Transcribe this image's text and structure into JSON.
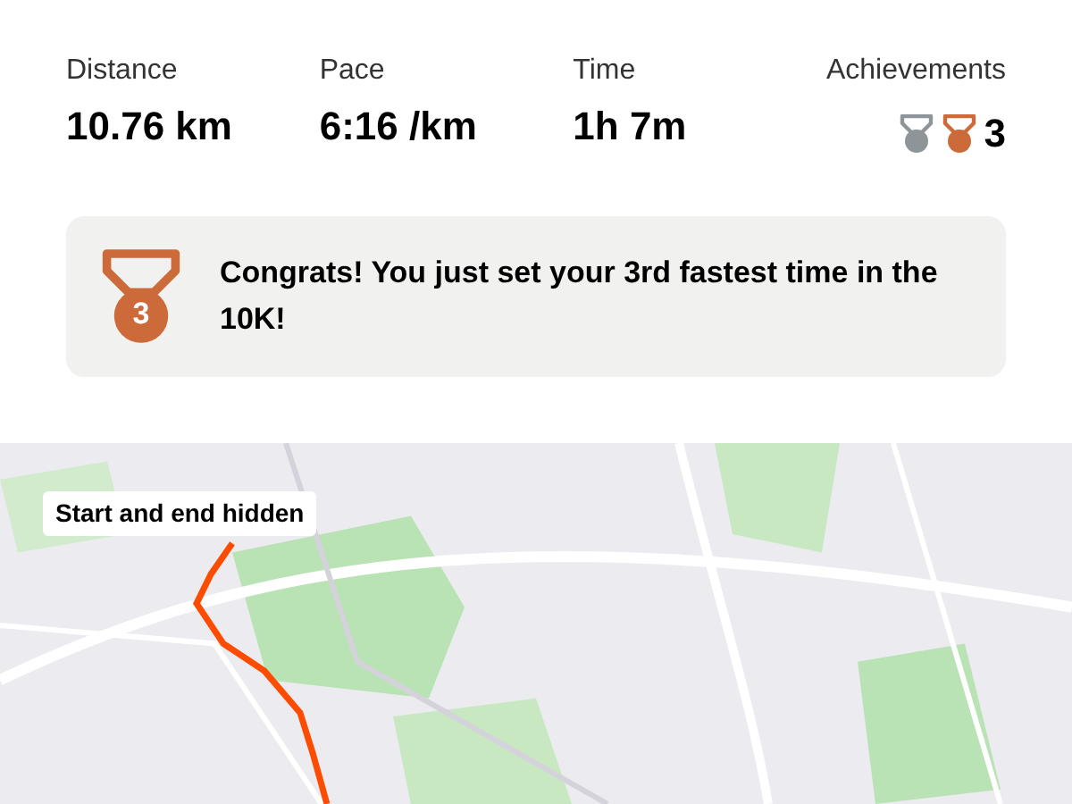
{
  "stats": [
    {
      "label": "Distance",
      "value": "10.76 km"
    },
    {
      "label": "Pace",
      "value": "6:16 /km"
    },
    {
      "label": "Time",
      "value": "1h 7m"
    }
  ],
  "achievements": {
    "label": "Achievements",
    "medals": [
      {
        "color": "#8e9599"
      },
      {
        "color": "#cc6a3a"
      }
    ],
    "count": "3"
  },
  "congrats": {
    "medal_number": "3",
    "message": "Congrats! You just set your 3rd fastest time in the 10K!"
  },
  "map": {
    "kind": "picture",
    "overlay_label": "Start and end hidden"
  }
}
